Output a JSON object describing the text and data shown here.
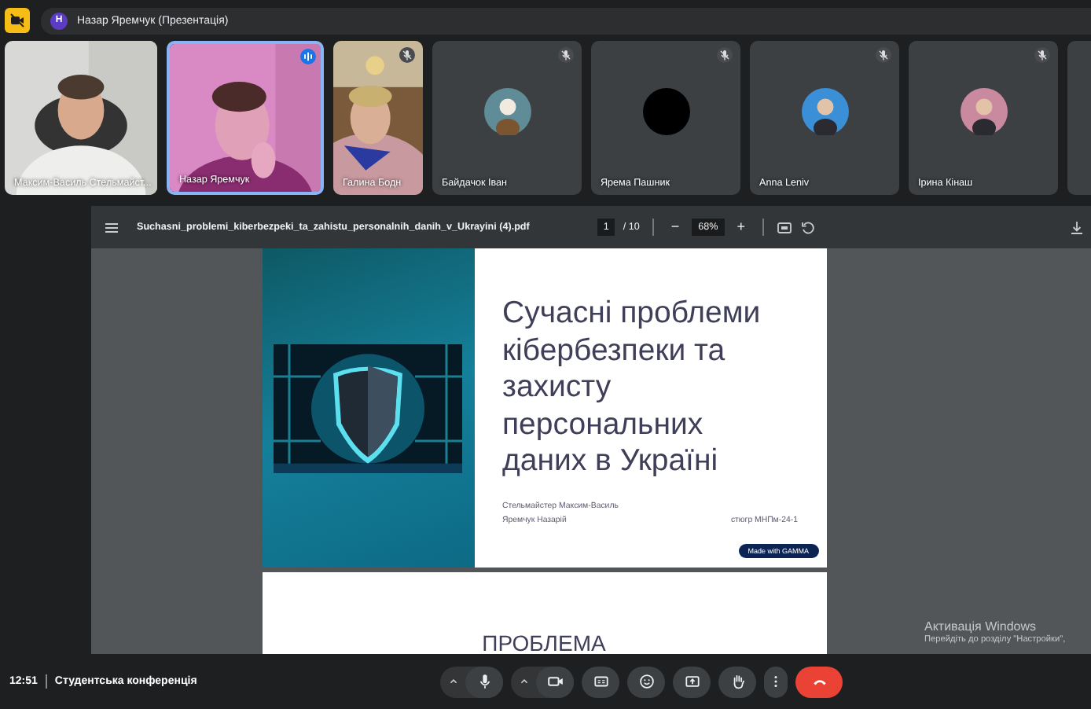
{
  "top_bar": {
    "avatar_letter": "Н",
    "title": "Назар Яремчук (Презентація)"
  },
  "participants": [
    {
      "name": "Максим-Василь Стельмайст...",
      "kind": "video",
      "muted": false,
      "speaking": false
    },
    {
      "name": "Назар Яремчук",
      "kind": "video",
      "muted": false,
      "speaking": true
    },
    {
      "name": "Галина Бодн",
      "kind": "video",
      "muted": true,
      "speaking": false
    },
    {
      "name": "Байдачок Іван",
      "kind": "avatar",
      "muted": true,
      "speaking": false
    },
    {
      "name": "Ярема Пашник",
      "kind": "blank-avatar",
      "muted": true,
      "speaking": false
    },
    {
      "name": "Anna Leniv",
      "kind": "avatar",
      "muted": true,
      "speaking": false
    },
    {
      "name": "Ірина Кінаш",
      "kind": "avatar",
      "muted": true,
      "speaking": false
    }
  ],
  "viewer": {
    "filename": "Suchasni_problemi_kiberbezpeki_ta_zahistu_personalnih_danih_v_Ukrayini (4).pdf",
    "page": "1",
    "page_count": "/ 10",
    "zoom_out": "−",
    "zoom": "68%",
    "zoom_in": "+"
  },
  "slide": {
    "title": "Сучасні проблеми кібербезпеки та захисту персональних даних в Україні",
    "authors": [
      "Стельмайстер Максим-Василь",
      "Яремчук Назарій"
    ],
    "group": "стюгр МНПм-24-1",
    "badge": "Made with GAMMA"
  },
  "next_slide": {
    "title": "ПРОБЛЕМА"
  },
  "os_notice": {
    "title": "Активація Windows",
    "text": "Перейдіть до розділу \"Настройки\","
  },
  "bottom_bar": {
    "time": "12:51",
    "meeting": "Студентська конференція"
  },
  "controls": [
    {
      "kind": "mic"
    },
    {
      "kind": "camera"
    },
    {
      "kind": "captions"
    },
    {
      "kind": "emoji"
    },
    {
      "kind": "present"
    },
    {
      "kind": "hand"
    },
    {
      "kind": "more"
    },
    {
      "kind": "end"
    }
  ]
}
